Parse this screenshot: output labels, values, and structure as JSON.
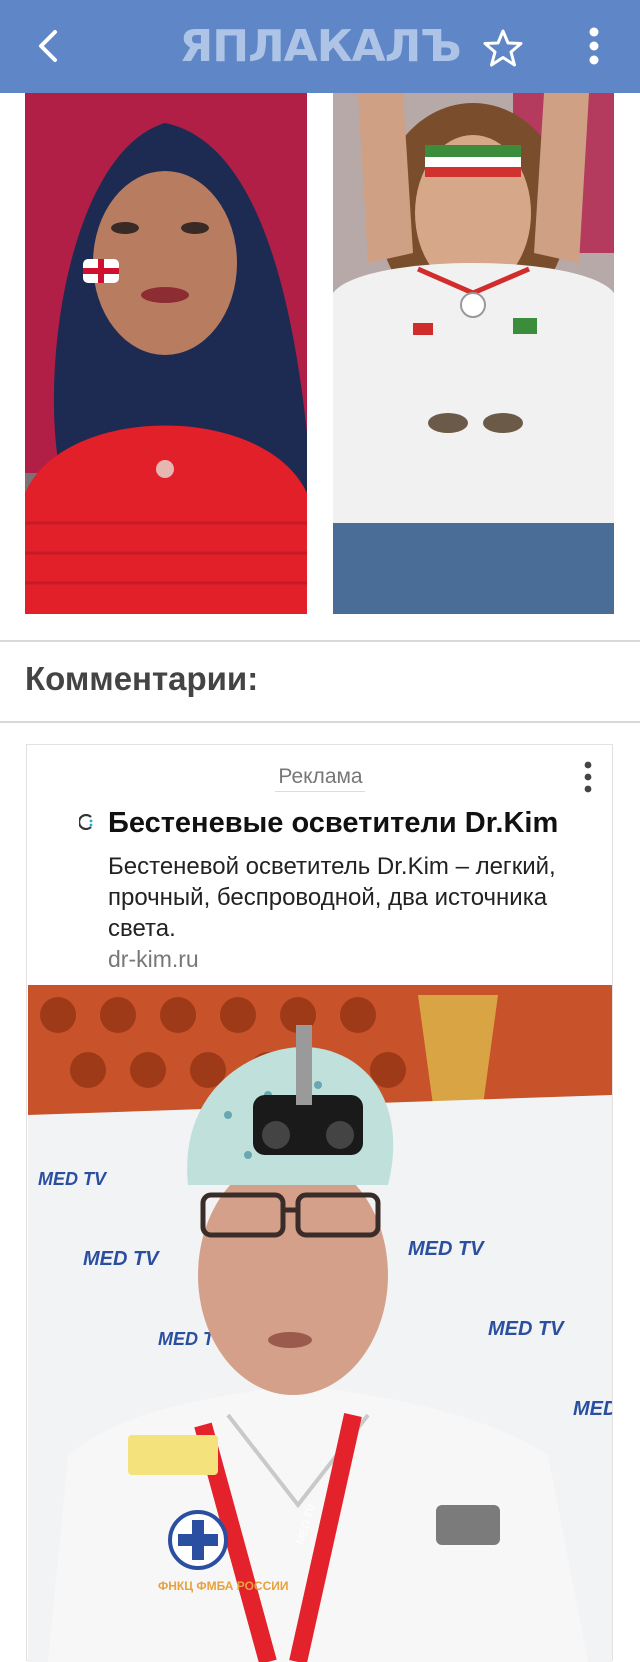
{
  "header": {
    "logo_text": "ЯПЛАКАЛЪ",
    "back_icon": "chevron-left-icon",
    "favorite_icon": "star-outline-icon",
    "menu_icon": "more-vertical-icon",
    "bar_color": "#5f86c6"
  },
  "post": {
    "images": [
      {
        "description_icon": "photo-fan-england"
      },
      {
        "description_icon": "photo-fan-iran"
      }
    ]
  },
  "comments": {
    "title": "Комментарии:"
  },
  "ad": {
    "label": "Реклама",
    "headline": "Бестеневые осветители Dr.Kim",
    "body": "Бестеневой осветитель Dr.Kim – легкий, прочный, беспроводной, два источника света.",
    "domain": "dr-kim.ru",
    "image_text": {
      "backdrop_logo": "MED TV",
      "badge_text": "ФНКЦ ФМБА РОССИИ",
      "lanyard_text": "MED TV"
    }
  }
}
